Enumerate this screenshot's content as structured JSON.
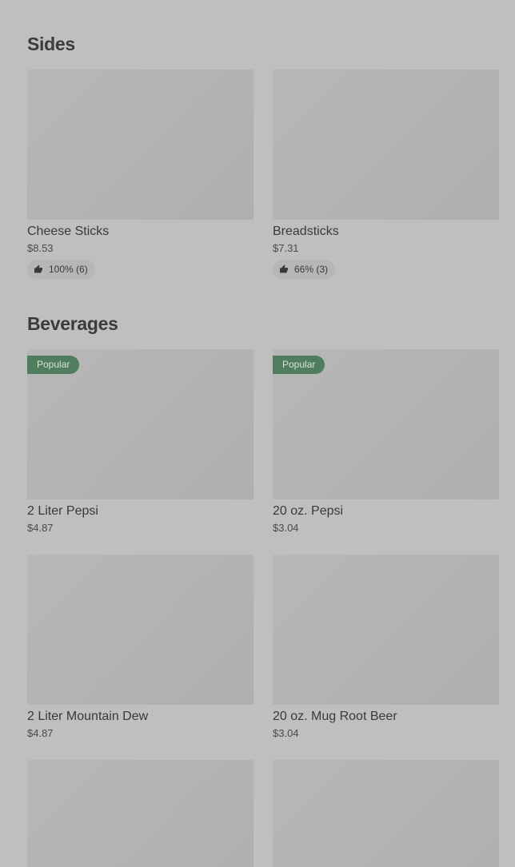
{
  "sections": [
    {
      "title": "Sides",
      "items": [
        {
          "name": "Cheese Sticks",
          "price": "$8.53",
          "rating": "100% (6)"
        },
        {
          "name": "Breadsticks",
          "price": "$7.31",
          "rating": "66% (3)"
        }
      ]
    },
    {
      "title": "Beverages",
      "items": [
        {
          "badge": "Popular",
          "name": "2 Liter Pepsi",
          "price": "$4.87"
        },
        {
          "badge": "Popular",
          "name": "20 oz. Pepsi",
          "price": "$3.04"
        },
        {
          "name": "2 Liter Mountain Dew",
          "price": "$4.87"
        },
        {
          "name": "20 oz. Mug Root Beer",
          "price": "$3.04"
        }
      ]
    }
  ],
  "colors": {
    "background": "#bfbfbf",
    "badge": "#4f7d5e",
    "text": "#3a3a3a"
  },
  "icons": {
    "rating": "thumbs-up-icon"
  }
}
